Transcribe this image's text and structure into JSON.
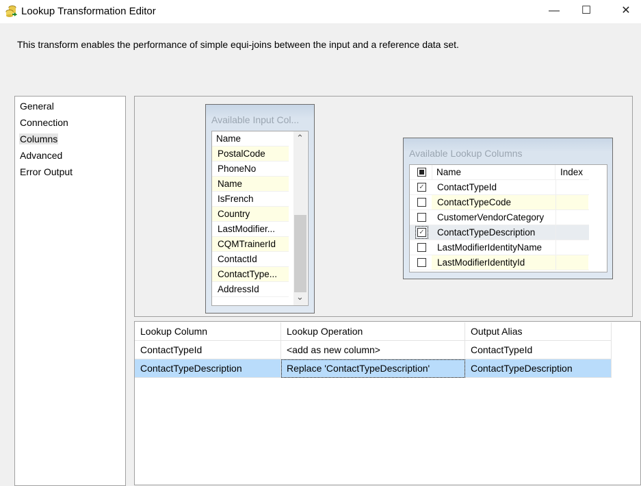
{
  "window": {
    "title": "Lookup Transformation Editor",
    "minimize": "—",
    "maximize": "☐",
    "close": "✕"
  },
  "description": "This transform enables the performance of simple equi-joins between the input and a reference data set.",
  "nav": {
    "items": [
      {
        "label": "General"
      },
      {
        "label": "Connection"
      },
      {
        "label": "Columns",
        "selected": true
      },
      {
        "label": "Advanced"
      },
      {
        "label": "Error Output"
      }
    ]
  },
  "input_columns": {
    "title": "Available Input Col...",
    "header": "Name",
    "rows": [
      "PostalCode",
      "PhoneNo",
      "Name",
      "IsFrench",
      "Country",
      "LastModifier...",
      "CQMTrainerId",
      "ContactId",
      "ContactType...",
      "AddressId"
    ],
    "scroll_up": "⌃",
    "scroll_down": "⌄"
  },
  "lookup_columns": {
    "title": "Available Lookup Columns",
    "headers": {
      "name": "Name",
      "index": "Index"
    },
    "rows": [
      {
        "name": "ContactTypeId",
        "checked": true
      },
      {
        "name": "ContactTypeCode",
        "checked": false
      },
      {
        "name": "CustomerVendorCategory",
        "checked": false
      },
      {
        "name": "ContactTypeDescription",
        "checked": true
      },
      {
        "name": "LastModifierIdentityName",
        "checked": false
      },
      {
        "name": "LastModifierIdentityId",
        "checked": false
      }
    ]
  },
  "grid": {
    "headers": [
      "Lookup Column",
      "Lookup Operation",
      "Output Alias"
    ],
    "rows": [
      [
        "ContactTypeId",
        "<add as new column>",
        "ContactTypeId"
      ],
      [
        "ContactTypeDescription",
        "Replace 'ContactTypeDescription'",
        "ContactTypeDescription"
      ]
    ]
  },
  "colors": {
    "selected_row": "#b9dcfb",
    "alt_row": "#fefee4"
  }
}
